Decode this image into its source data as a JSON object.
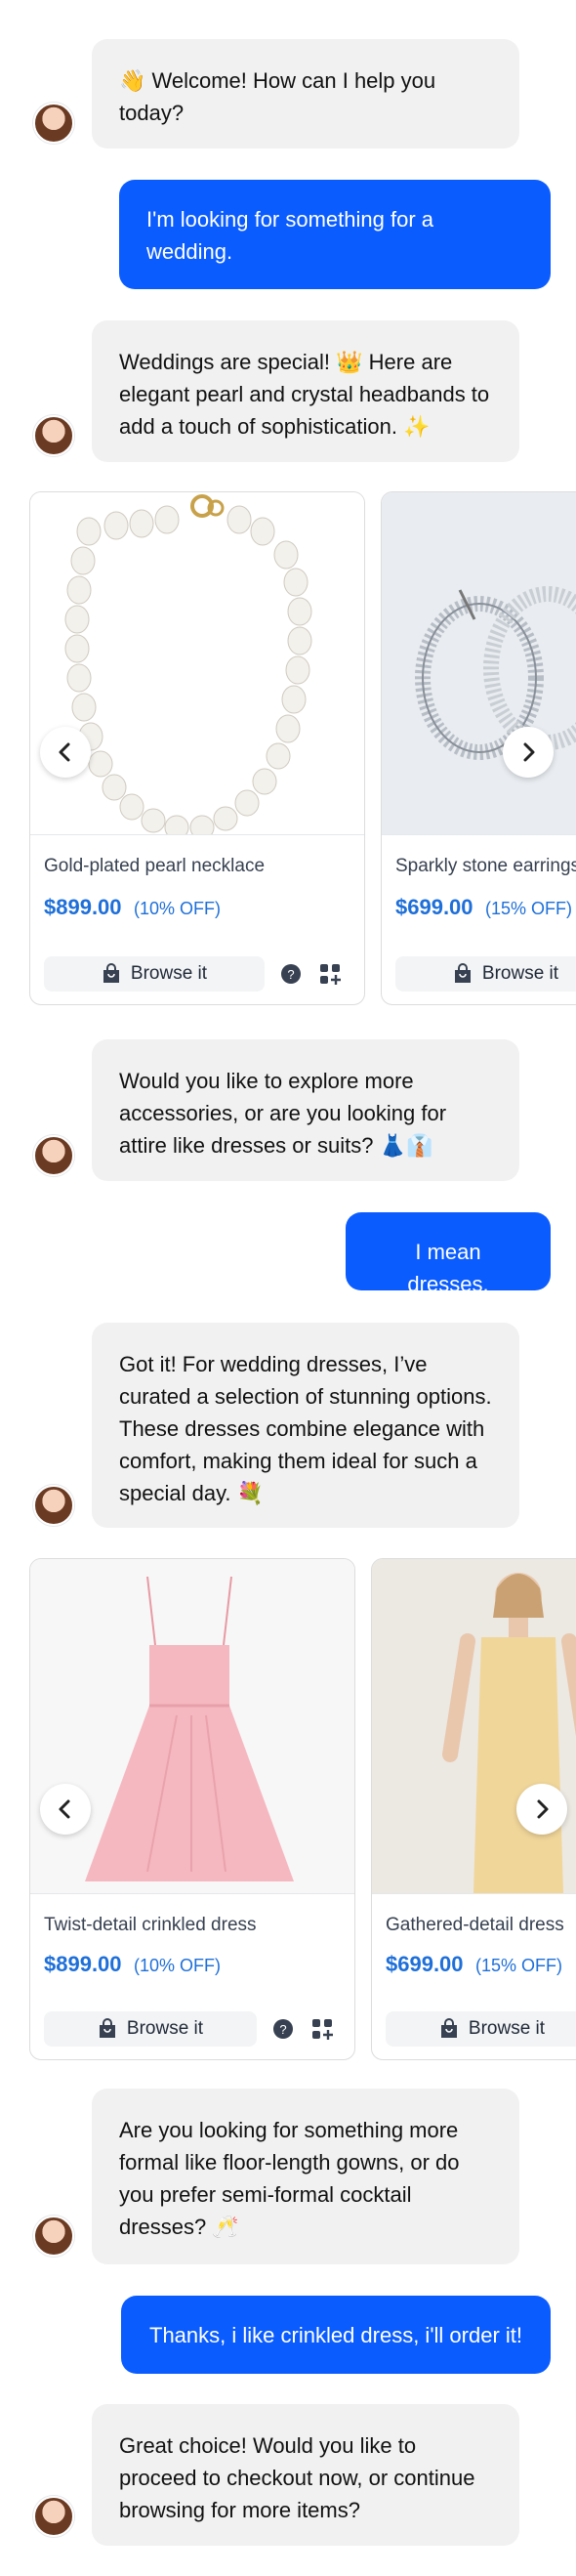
{
  "messages": {
    "m1": "👋 Welcome! How can I help you today?",
    "m2": "I'm looking for something for a wedding.",
    "m3": "Weddings are special! 👑 Here are elegant pearl and crystal headbands to add a touch of sophistication. ✨",
    "m4": "Would you like to explore more accessories, or are you looking for attire like dresses or suits? 👗👔",
    "m5": "I mean dresses.",
    "m6": "Got it! For wedding dresses, I’ve curated a selection of stunning options. These dresses combine elegance with comfort, making them ideal for such a special day. 💐",
    "m7": "Are you looking for something more formal like floor-length gowns, or do you prefer semi-formal cocktail dresses? 🥂",
    "m8": "Thanks, i like crinkled dress, i'll order it!",
    "m9": "Great choice! Would you like to proceed to checkout now, or continue browsing for more items?"
  },
  "carousel1": {
    "products": [
      {
        "name": "Gold-plated pearl necklace",
        "price": "$899.00",
        "discount": "(10% OFF)",
        "browse_label": "Browse it"
      },
      {
        "name": "Sparkly stone earrings",
        "price": "$699.00",
        "discount": "(15% OFF)",
        "browse_label": "Browse it"
      }
    ]
  },
  "carousel2": {
    "products": [
      {
        "name": "Twist-detail crinkled dress",
        "price": "$899.00",
        "discount": "(10% OFF)",
        "browse_label": "Browse it"
      },
      {
        "name": "Gathered-detail dress",
        "price": "$699.00",
        "discount": "(15% OFF)",
        "browse_label": "Browse it"
      }
    ]
  },
  "colors": {
    "accent": "#0b5cff",
    "price": "#1e6fd9",
    "bot_bubble": "#f1f1f1"
  },
  "icons": [
    "avatar",
    "chevron-left-icon",
    "chevron-right-icon",
    "shopping-bag-icon",
    "chat-question-icon",
    "add-grid-icon"
  ]
}
